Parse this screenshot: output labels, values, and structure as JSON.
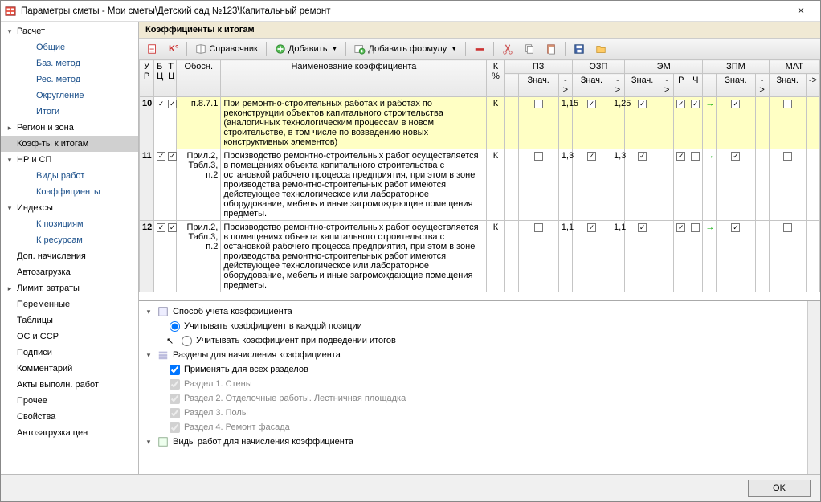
{
  "title": "Параметры сметы - Мои сметы\\Детский сад №123\\Капитальный ремонт",
  "sidebar": [
    {
      "label": "Расчет",
      "lvl": 1,
      "exp": "down"
    },
    {
      "label": "Общие",
      "lvl": 2
    },
    {
      "label": "Баз. метод",
      "lvl": 2
    },
    {
      "label": "Рес. метод",
      "lvl": 2
    },
    {
      "label": "Округление",
      "lvl": 2
    },
    {
      "label": "Итоги",
      "lvl": 2
    },
    {
      "label": "Регион и зона",
      "lvl": 1,
      "exp": "right"
    },
    {
      "label": "Коэф-ты к итогам",
      "lvl": 1,
      "sel": true
    },
    {
      "label": "НР и СП",
      "lvl": 1,
      "exp": "down"
    },
    {
      "label": "Виды работ",
      "lvl": 2
    },
    {
      "label": "Коэффициенты",
      "lvl": 2
    },
    {
      "label": "Индексы",
      "lvl": 1,
      "exp": "down"
    },
    {
      "label": "К позициям",
      "lvl": 2
    },
    {
      "label": "К ресурсам",
      "lvl": 2
    },
    {
      "label": "Доп. начисления",
      "lvl": 1
    },
    {
      "label": "Автозагрузка",
      "lvl": 1
    },
    {
      "label": "Лимит. затраты",
      "lvl": 1,
      "exp": "right"
    },
    {
      "label": "Переменные",
      "lvl": 1
    },
    {
      "label": "Таблицы",
      "lvl": 1
    },
    {
      "label": "ОС и ССР",
      "lvl": 1
    },
    {
      "label": "Подписи",
      "lvl": 1
    },
    {
      "label": "Комментарий",
      "lvl": 1
    },
    {
      "label": "Акты выполн. работ",
      "lvl": 1
    },
    {
      "label": "Прочее",
      "lvl": 1
    },
    {
      "label": "Свойства",
      "lvl": 1
    },
    {
      "label": "Автозагрузка цен",
      "lvl": 1
    }
  ],
  "sectionHeader": "Коэффициенты к итогам",
  "toolbar": {
    "ref": "Справочник",
    "add": "Добавить",
    "addf": "Добавить формулу"
  },
  "headers": {
    "ur": "У\nР",
    "bc": "Б\nЦ",
    "tc": "Т\nЦ",
    "ob": "Обосн.",
    "nm": "Наименование коэффициента",
    "kp": "К\n%",
    "pz": "ПЗ",
    "ozp": "ОЗП",
    "em": "ЭМ",
    "zpm": "ЗПМ",
    "mat": "МАТ",
    "zn": "Знач.",
    "ar": "->",
    "r": "Р",
    "ch": "Ч"
  },
  "rows": [
    {
      "n": "10",
      "hl": true,
      "ob": "п.8.7.1",
      "nm": "При ремонтно-строительных работах и работах по реконструкции объектов капитального строительства (аналогичных технологическим процессам в новом строительстве, в том числе по возведению новых конструктивных элементов)",
      "kp": "К",
      "ozp": "1,15",
      "em": "1,25",
      "bc": true,
      "tc": true,
      "pzc": false,
      "ozpc": true,
      "emc": true,
      "rc": true,
      "chc": true,
      "zpmc": true,
      "matc": false
    },
    {
      "n": "11",
      "ob": "Прил.2, Табл.3, п.2",
      "nm": "Производство ремонтно-строительных работ осуществляется в помещениях объекта капитального строительства с остановкой рабочего процесса предприятия, при этом в зоне производства ремонтно-строительных работ имеются действующее технологическое или лабораторное оборудование, мебель и иные загромождающие помещения предметы.",
      "kp": "К",
      "ozp": "1,3",
      "em": "1,3",
      "bc": true,
      "tc": true,
      "pzc": false,
      "ozpc": true,
      "emc": true,
      "rc": true,
      "chc": false,
      "zpmc": true,
      "matc": false
    },
    {
      "n": "12",
      "ob": "Прил.2, Табл.3, п.2",
      "nm": "Производство ремонтно-строительных работ осуществляется в помещениях объекта капитального строительства с остановкой рабочего процесса предприятия, при этом в зоне производства ремонтно-строительных работ имеются действующее технологическое или лабораторное оборудование, мебель и иные загромождающие помещения предметы.",
      "kp": "К",
      "ozp": "1,1",
      "em": "1,1",
      "bc": true,
      "tc": true,
      "pzc": false,
      "ozpc": true,
      "emc": true,
      "rc": true,
      "chc": false,
      "zpmc": true,
      "matc": false
    }
  ],
  "options": {
    "h1": "Способ учета коэффициента",
    "r1": "Учитывать коэффициент в каждой позиции",
    "r2": "Учитывать коэффициент при подведении итогов",
    "h2": "Разделы для начисления коэффициента",
    "c1": "Применять для всех разделов",
    "s1": "Раздел 1. Стены",
    "s2": "Раздел 2. Отделочные работы. Лестничная площадка",
    "s3": "Раздел 3. Полы",
    "s4": "Раздел 4. Ремонт фасада",
    "h3": "Виды работ для начисления коэффициента"
  },
  "ok": "OK"
}
